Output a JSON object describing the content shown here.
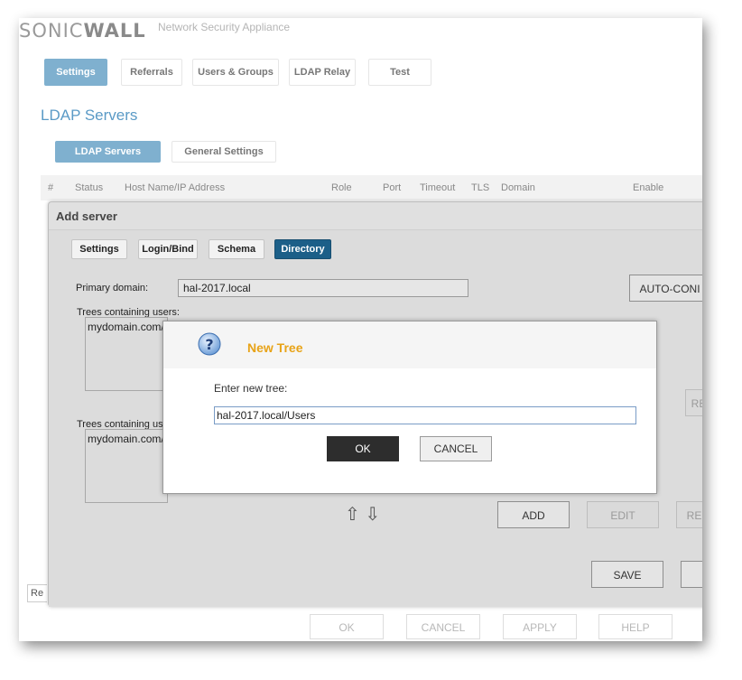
{
  "app": {
    "logo_text_left": "SONIC",
    "logo_text_right": "WALL",
    "tagline": "Network Security Appliance"
  },
  "top_tabs": [
    {
      "label": "Settings",
      "active": true
    },
    {
      "label": "Referrals",
      "active": false
    },
    {
      "label": "Users & Groups",
      "active": false
    },
    {
      "label": "LDAP Relay",
      "active": false
    },
    {
      "label": "Test",
      "active": false
    }
  ],
  "section_title": "LDAP Servers",
  "sub_tabs": [
    {
      "label": "LDAP Servers",
      "active": true
    },
    {
      "label": "General Settings",
      "active": false
    }
  ],
  "table_headers": [
    "#",
    "Status",
    "Host Name/IP Address",
    "Role",
    "Port",
    "Timeout",
    "TLS",
    "Domain",
    "Enable"
  ],
  "modal": {
    "title": "Add server",
    "tabs": [
      {
        "label": "Settings",
        "active": false
      },
      {
        "label": "Login/Bind",
        "active": false
      },
      {
        "label": "Schema",
        "active": false
      },
      {
        "label": "Directory",
        "active": true
      }
    ],
    "primary_domain_label": "Primary domain:",
    "primary_domain_value": "hal-2017.local",
    "auto_config_label": "AUTO-CONI",
    "trees_users_label": "Trees containing users:",
    "trees_users_item": "mydomain.com/",
    "trees_groups_label": "Trees containing us",
    "trees_groups_item": "mydomain.com/",
    "side_btn_1": "RE",
    "side_btn_2": "RE",
    "add_label": "ADD",
    "edit_label": "EDIT",
    "save_label": "SAVE",
    "arrows": "⇧ ⇩"
  },
  "dialog": {
    "title": "New Tree",
    "prompt": "Enter new tree:",
    "input_value": "hal-2017.local/Users",
    "ok_label": "OK",
    "cancel_label": "CANCEL"
  },
  "footer_buttons": [
    {
      "label": "OK"
    },
    {
      "label": "CANCEL"
    },
    {
      "label": "APPLY"
    },
    {
      "label": "HELP"
    }
  ],
  "left_stub": "Re",
  "colors": {
    "tab_active": "#7fb0cf",
    "title_blue": "#5a9ac6",
    "dialog_title": "#e8a317",
    "directory_tab": "#1c5f88",
    "ok_button": "#2d2d2d"
  }
}
